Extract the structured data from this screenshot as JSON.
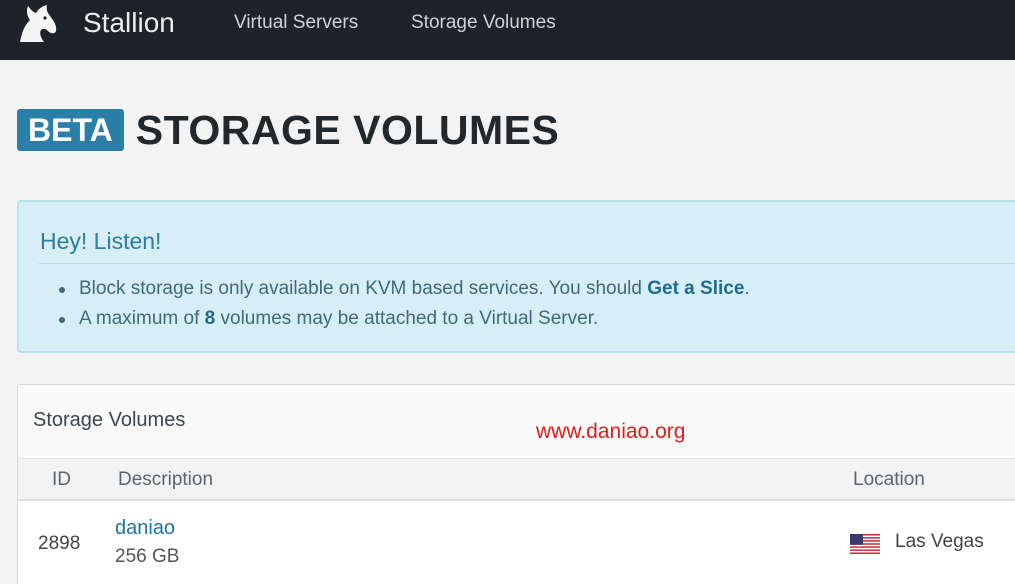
{
  "navbar": {
    "brand": "Stallion",
    "logo_icon": "horse-head-icon",
    "items": [
      {
        "label": "Virtual Servers"
      },
      {
        "label": "Storage Volumes"
      }
    ]
  },
  "page": {
    "badge": "BETA",
    "title": "STORAGE VOLUMES"
  },
  "alert": {
    "heading": "Hey! Listen!",
    "line1_text": "Block storage is only available on KVM based services. You should ",
    "line1_link": "Get a Slice",
    "line1_end": ".",
    "line2_pre": "A maximum of ",
    "line2_count": "8",
    "line2_post": " volumes may be attached to a Virtual Server."
  },
  "panel": {
    "title": "Storage Volumes",
    "watermark": "www.daniao.org",
    "columns": {
      "id": "ID",
      "description": "Description",
      "location": "Location"
    },
    "rows": [
      {
        "id": "2898",
        "name": "daniao",
        "size": "256 GB",
        "flag_icon": "us-flag-icon",
        "location": "Las Vegas"
      }
    ]
  },
  "colors": {
    "navbar_bg": "#1f2327",
    "badge_bg": "#2a7fa8",
    "alert_bg": "#d8eef6",
    "link": "#1d6d93",
    "watermark": "#e21b1b"
  }
}
